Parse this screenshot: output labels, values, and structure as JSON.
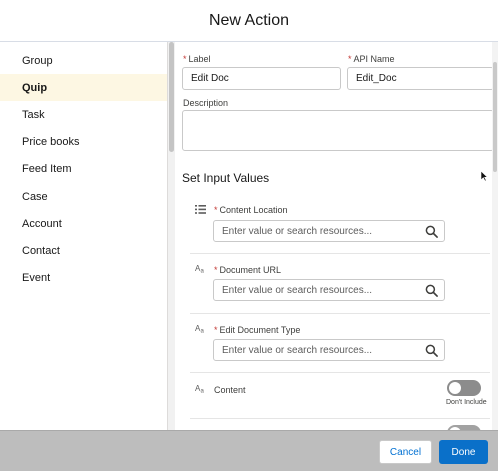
{
  "modal": {
    "title": "New Action"
  },
  "sidebar": {
    "items": [
      {
        "label": "Group"
      },
      {
        "label": "Quip"
      },
      {
        "label": "Task"
      },
      {
        "label": "Price books"
      },
      {
        "label": "Feed Item"
      },
      {
        "label": "Case"
      },
      {
        "label": "Account"
      },
      {
        "label": "Contact"
      },
      {
        "label": "Event"
      }
    ],
    "active_index": 1
  },
  "form": {
    "label_field": {
      "label": "Label",
      "value": "Edit Doc"
    },
    "api_name_field": {
      "label": "API Name",
      "value": "Edit_Doc"
    },
    "description_field": {
      "label": "Description",
      "value": ""
    },
    "section_title": "Set Input Values",
    "inputs": [
      {
        "icon": "list-icon",
        "label": "Content Location",
        "placeholder": "Enter value or search resources..."
      },
      {
        "icon": "text-icon",
        "label": "Document URL",
        "placeholder": "Enter value or search resources..."
      },
      {
        "icon": "text-icon",
        "label": "Edit Document Type",
        "placeholder": "Enter value or search resources..."
      }
    ],
    "content_toggle": {
      "label": "Content",
      "caption": "Don't Include",
      "on": false
    }
  },
  "footer": {
    "cancel_label": "Cancel",
    "done_label": "Done"
  },
  "colors": {
    "brand": "#0a70c9",
    "required": "#c23934",
    "active_bg": "#fdf7e3"
  }
}
